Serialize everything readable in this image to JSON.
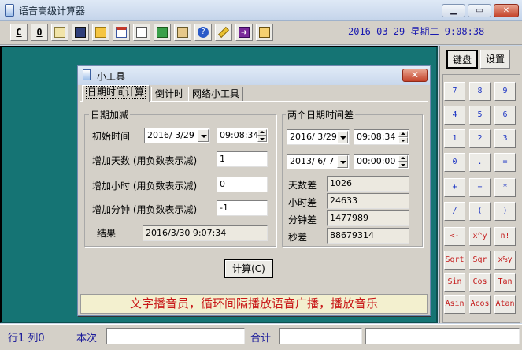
{
  "window": {
    "title": "语音高级计算器",
    "minimize_icon": "minimize-icon",
    "maximize_icon": "maximize-icon",
    "close_icon": "close-icon"
  },
  "toolbar": {
    "buttons": [
      {
        "label": "C",
        "icon": "clear"
      },
      {
        "label": "0",
        "icon": "zero"
      },
      {
        "icon": "paste-icon"
      },
      {
        "icon": "save-icon"
      },
      {
        "icon": "open-folder-icon"
      },
      {
        "icon": "calendar-icon"
      },
      {
        "icon": "print-preview-icon"
      },
      {
        "icon": "home-icon"
      },
      {
        "icon": "speaker-icon"
      },
      {
        "icon": "help-icon"
      },
      {
        "icon": "pin-icon"
      },
      {
        "icon": "arrow-right-icon"
      },
      {
        "icon": "exit-icon"
      }
    ],
    "datetime": "2016-03-29 星期二 9:08:38"
  },
  "right_panel": {
    "tabs": [
      "键盘",
      "设置"
    ],
    "keys": [
      [
        "7",
        "8",
        "9"
      ],
      [
        "4",
        "5",
        "6"
      ],
      [
        "1",
        "2",
        "3"
      ],
      [
        "0",
        ".",
        "="
      ],
      [
        "+",
        "−",
        "*"
      ],
      [
        "/",
        "(",
        ")"
      ],
      [
        "<-",
        "x^y",
        "n!"
      ],
      [
        "Sqrt",
        "Sqr",
        "x%y"
      ],
      [
        "Sin",
        "Cos",
        "Tan"
      ],
      [
        "Asin",
        "Acos",
        "Atan"
      ]
    ]
  },
  "dialog": {
    "title": "小工具",
    "close_label": "✕",
    "tabs": [
      "日期时间计算",
      "倒计时",
      "网络小工具"
    ],
    "date_add": {
      "group_title": "日期加减",
      "start_label": "初始时间",
      "start_date": "2016/ 3/29",
      "start_time": "09:08:34",
      "add_days_label": "增加天数 (用负数表示减)",
      "add_days_value": "1",
      "add_hours_label": "增加小时 (用负数表示减)",
      "add_hours_value": "0",
      "add_minutes_label": "增加分钟 (用负数表示减)",
      "add_minutes_value": "-1",
      "result_label": "结果",
      "result_value": "2016/3/30 9:07:34"
    },
    "date_diff": {
      "group_title": "两个日期时间差",
      "date1": "2016/ 3/29",
      "time1": "09:08:34",
      "date2": "2013/ 6/ 7",
      "time2": "00:00:00",
      "days_label": "天数差",
      "days_value": "1026",
      "hours_label": "小时差",
      "hours_value": "24633",
      "minutes_label": "分钟差",
      "minutes_value": "1477989",
      "seconds_label": "秒差",
      "seconds_value": "88679314"
    },
    "calc_button": "计算(C)",
    "marquee": "文字播音员，循环间隔播放语音广播，播放音乐"
  },
  "status": {
    "position": "行1 列0",
    "this_time_label": "本次",
    "total_label": "合计"
  }
}
